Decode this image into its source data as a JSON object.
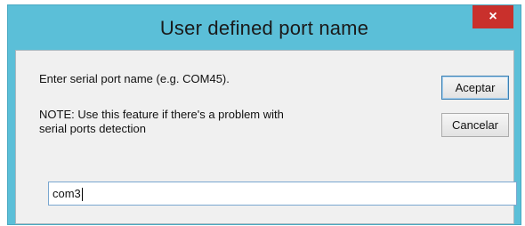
{
  "window": {
    "title": "User defined port name",
    "close_label": "×"
  },
  "dialog": {
    "prompt": "Enter serial port name (e.g. COM45).",
    "note_line1": "NOTE: Use this feature if there's a problem with",
    "note_line2": "serial ports detection",
    "accept_label": "Aceptar",
    "cancel_label": "Cancelar",
    "input_value": "com3"
  },
  "colors": {
    "titlebar": "#5bbfd8",
    "close_button": "#c9302c",
    "client_background": "#f0f0f0"
  }
}
